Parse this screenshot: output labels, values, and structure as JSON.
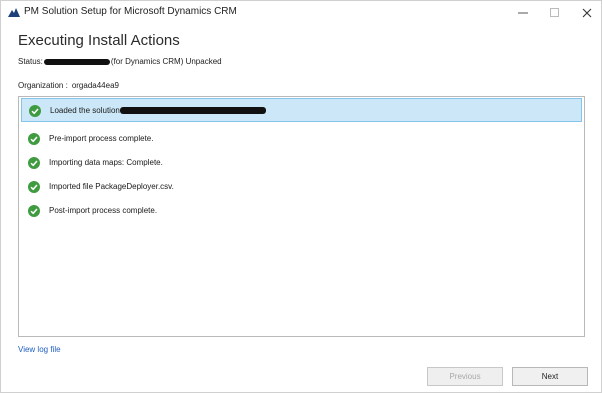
{
  "window": {
    "title": "PM Solution Setup for Microsoft Dynamics CRM",
    "icon": "dynamics-logo-icon",
    "controls": [
      "minimize-icon",
      "maximize-icon",
      "close-icon"
    ]
  },
  "page": {
    "heading": "Executing Install Actions",
    "status_prefix": "Status:",
    "status_suffix": "(for Dynamics CRM) Unpacked",
    "organization_label": "Organization :",
    "organization_value": "orgada44ea9"
  },
  "actions": [
    {
      "label": "Loaded the solution",
      "status": "complete",
      "selected": true,
      "redacted": true
    },
    {
      "label": "Pre-import process complete.",
      "status": "complete",
      "selected": false
    },
    {
      "label": "Importing data maps: Complete.",
      "status": "complete",
      "selected": false
    },
    {
      "label": "Imported file PackageDeployer.csv.",
      "status": "complete",
      "selected": false
    },
    {
      "label": "Post-import process complete.",
      "status": "complete",
      "selected": false
    }
  ],
  "footer": {
    "log_link": "View log file",
    "previous_label": "Previous",
    "next_label": "Next"
  },
  "colors": {
    "accent_link": "#1f5fbf",
    "check_green": "#3f9b3f",
    "selection_fill": "#cce8f8",
    "selection_border": "#86c4ea"
  }
}
